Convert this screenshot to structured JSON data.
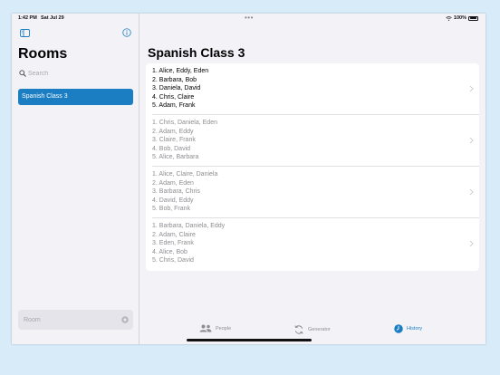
{
  "status": {
    "time": "1:42 PM",
    "date": "Sat Jul 29",
    "battery": "100%"
  },
  "sidebar": {
    "title": "Rooms",
    "search_placeholder": "Search",
    "rooms": [
      {
        "label": "Spanish Class 3",
        "selected": true
      }
    ],
    "new_room_placeholder": "Room"
  },
  "main": {
    "title": "Spanish Class 3",
    "history": [
      {
        "current": true,
        "lines": [
          "1. Alice, Eddy, Eden",
          "2. Barbara, Bob",
          "3. Daniela, David",
          "4. Chris, Claire",
          "5. Adam, Frank"
        ]
      },
      {
        "current": false,
        "lines": [
          "1. Chris, Daniela, Eden",
          "2. Adam, Eddy",
          "3. Claire, Frank",
          "4. Bob, David",
          "5. Alice, Barbara"
        ]
      },
      {
        "current": false,
        "lines": [
          "1. Alice, Claire, Daniela",
          "2. Adam, Eden",
          "3. Barbara, Chris",
          "4. David, Eddy",
          "5. Bob, Frank"
        ]
      },
      {
        "current": false,
        "lines": [
          "1. Barbara, Daniela, Eddy",
          "2. Adam, Claire",
          "3. Eden, Frank",
          "4. Alice, Bob",
          "5. Chris, David"
        ]
      }
    ]
  },
  "tabbar": {
    "tabs": [
      {
        "label": "People",
        "icon": "people-icon",
        "active": false
      },
      {
        "label": "Generator",
        "icon": "generator-icon",
        "active": false
      },
      {
        "label": "History",
        "icon": "history-icon",
        "active": true
      }
    ]
  },
  "colors": {
    "accent": "#1b7ec2",
    "background": "#d7ecf8",
    "secondary_text": "#8e8e93"
  }
}
